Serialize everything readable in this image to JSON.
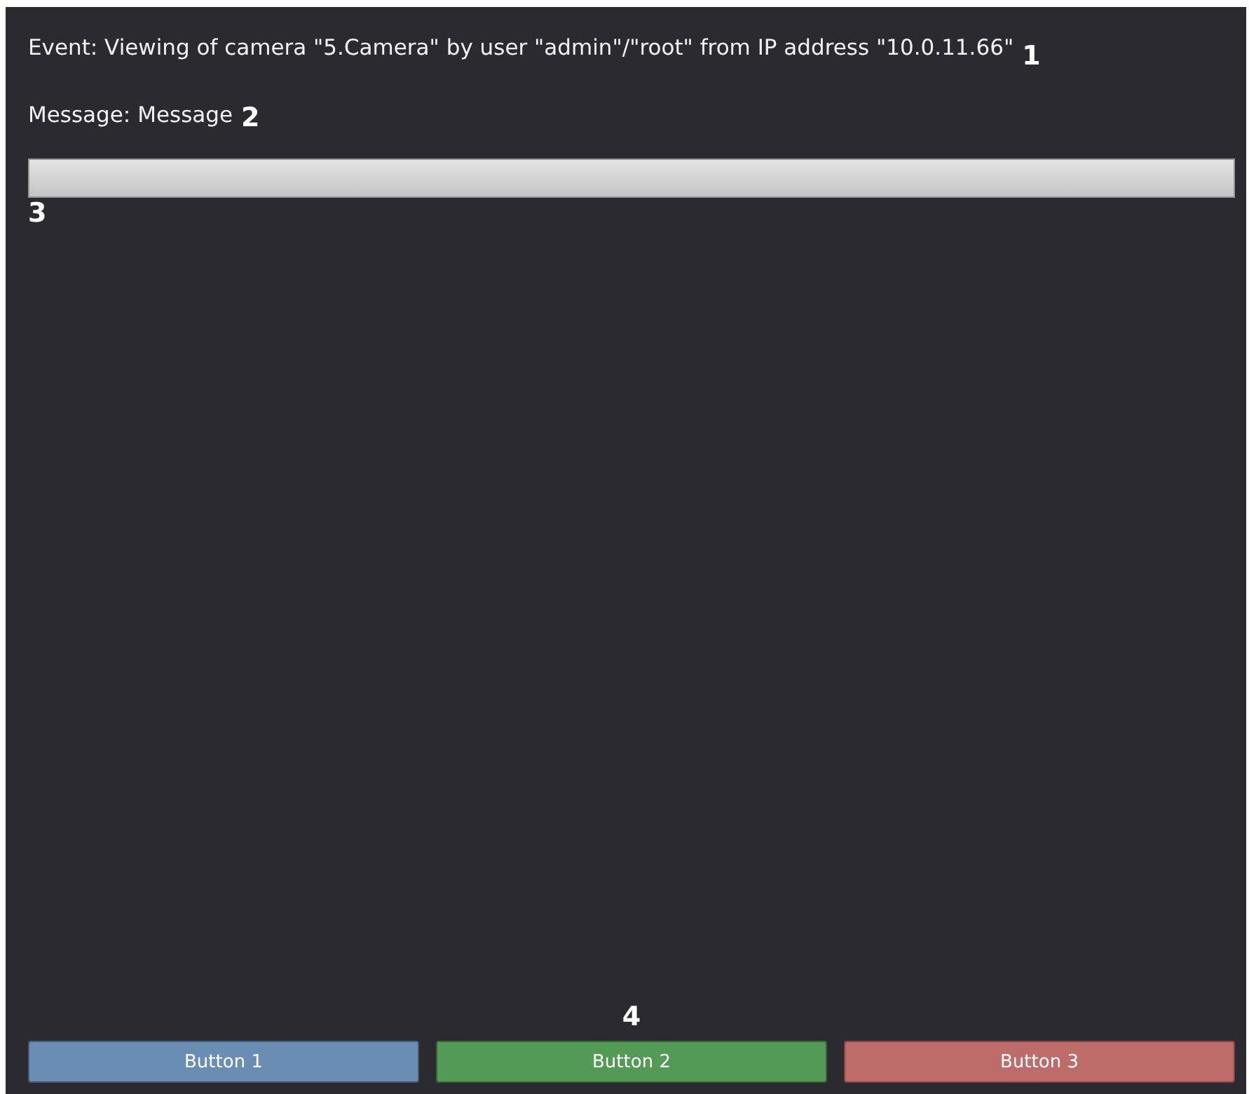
{
  "event_text": "Event: Viewing of camera \"5.Camera\" by user \"admin\"/\"root\" from IP address \"10.0.11.66\"",
  "message_text": "Message: Message",
  "callouts": [
    "1",
    "2",
    "3",
    "4"
  ],
  "buttons": [
    {
      "label": "Button 1",
      "color": "#6a8db3"
    },
    {
      "label": "Button 2",
      "color": "#549a57"
    },
    {
      "label": "Button 3",
      "color": "#bd6c69"
    }
  ]
}
